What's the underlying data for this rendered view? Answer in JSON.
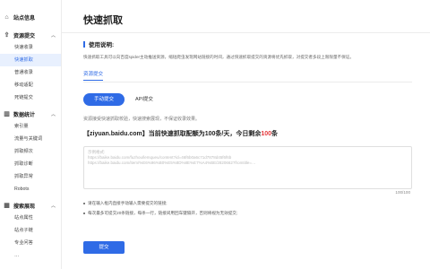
{
  "sidebar": {
    "groups": [
      {
        "label": "站点信息",
        "icon": "home-icon",
        "expanded": false,
        "items": []
      },
      {
        "label": "资源提交",
        "icon": "upload-icon",
        "expanded": true,
        "items": [
          "快速收录",
          "快速抓取",
          "普通收录",
          "移动适配",
          "死链提交"
        ]
      },
      {
        "label": "数据统计",
        "icon": "stats-icon",
        "expanded": true,
        "items": [
          "索引量",
          "流量与关键词",
          "抓取频次",
          "抓取诊断",
          "抓取异常",
          "Robots"
        ]
      },
      {
        "label": "搜索展现",
        "icon": "search-display-icon",
        "expanded": true,
        "items": [
          "站点属性",
          "站点子链",
          "专业问答",
          "…"
        ]
      }
    ],
    "active_item": "快速抓取"
  },
  "main": {
    "title": "快速抓取",
    "usage_title": "使用说明:",
    "usage_text": "快速抓取工具可以向百度spider主动推送资源，缩短爬虫发现网站链接的时间，通过快速抓取提交的资源将优先抓取，对提交者多段上限限量不保证。",
    "section_tab": "资源提交",
    "tabs": [
      {
        "label": "手动提交",
        "active": true
      },
      {
        "label": "API提交",
        "active": false
      }
    ],
    "desc": "资源接受快速抓取校验，快速搜索展现，不保证收录效果。",
    "quota": {
      "prefix": "【ziyuan.baidu.com】当前快速抓取配额为100条/天，今日剩余",
      "remaining": "100",
      "suffix": "条"
    },
    "textarea": {
      "lines": [
        "示例格式:",
        "https://baike.baidu.com/fuzhou/lemqueu/content?id=46f6b0a6c71d7878d45f6f6b",
        "https://baike.baidu.com/item/%E6%96%B0%E5%8D%8E%E7%A4%BE/2820662?fromtitle=…"
      ]
    },
    "count": "100/100",
    "notes": [
      "请在输入框内直接手动输入需要提交的链接;",
      "每次最多可提交20条链接，每条一行，链接间用回车键隔开，否则将视为无效提交;"
    ],
    "submit_label": "提交"
  },
  "colors": {
    "accent": "#2f6be6",
    "highlight": "#e4393c"
  }
}
